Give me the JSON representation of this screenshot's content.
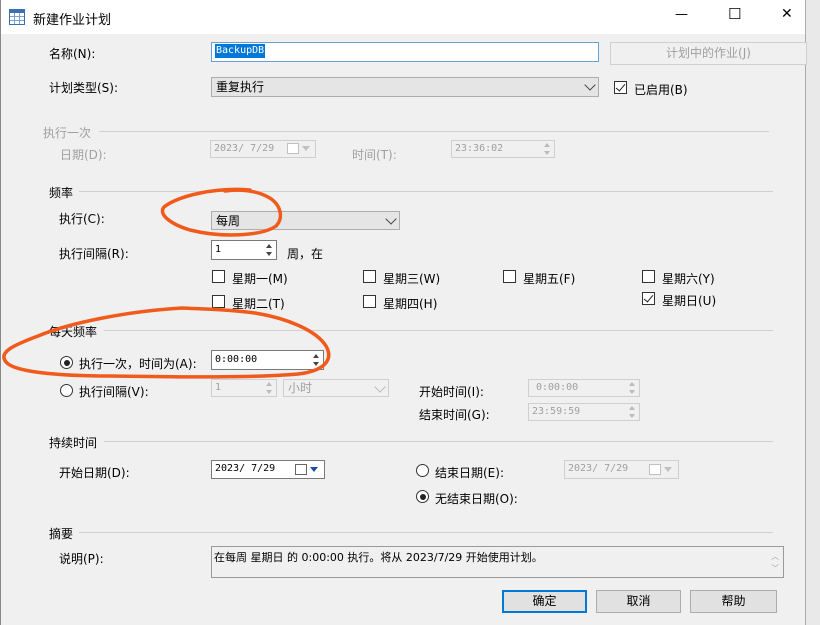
{
  "window": {
    "title": "新建作业计划",
    "controls": {
      "minimize": "—",
      "maximize": "☐",
      "close": "✕"
    }
  },
  "name": {
    "label": "名称(N):",
    "value": "BackupDB",
    "jobs_button": "计划中的作业(J)"
  },
  "schedule_type": {
    "label": "计划类型(S):",
    "value": "重复执行",
    "enabled_label": "已启用(B)",
    "enabled": true
  },
  "one_time": {
    "section": "执行一次",
    "date_label": "日期(D):",
    "date_value": "2023/ 7/29",
    "time_label": "时间(T):",
    "time_value": "23:36:02"
  },
  "frequency": {
    "section": "频率",
    "occurs_label": "执行(C):",
    "occurs_value": "每周",
    "recurs_label": "执行间隔(R):",
    "recurs_value": "1",
    "recurs_suffix": "周，在",
    "days": [
      {
        "label": "星期一(M)",
        "checked": false
      },
      {
        "label": "星期二(T)",
        "checked": false
      },
      {
        "label": "星期三(W)",
        "checked": false
      },
      {
        "label": "星期四(H)",
        "checked": false
      },
      {
        "label": "星期五(F)",
        "checked": false
      },
      {
        "label": "星期六(Y)",
        "checked": false
      },
      {
        "label": "星期日(U)",
        "checked": true
      }
    ]
  },
  "daily_frequency": {
    "section": "每天频率",
    "once_label": "执行一次，时间为(A):",
    "once_value": "0:00:00",
    "once_selected": true,
    "every_label": "执行间隔(V):",
    "every_value": "1",
    "every_unit": "小时",
    "start_label": "开始时间(I):",
    "start_value": "0:00:00",
    "end_label": "结束时间(G):",
    "end_value": "23:59:59"
  },
  "duration": {
    "section": "持续时间",
    "start_label": "开始日期(D):",
    "start_value": "2023/ 7/29",
    "end_label": "结束日期(E):",
    "end_value": "2023/ 7/29",
    "no_end_label": "无结束日期(O):",
    "no_end_selected": true
  },
  "summary": {
    "section": "摘要",
    "desc_label": "说明(P):",
    "desc_value": "在每周 星期日 的 0:00:00 执行。将从 2023/7/29 开始使用计划。"
  },
  "buttons": {
    "ok": "确定",
    "cancel": "取消",
    "help": "帮助"
  },
  "colors": {
    "annotation": "#f05a1a",
    "accent": "#0078d7"
  }
}
